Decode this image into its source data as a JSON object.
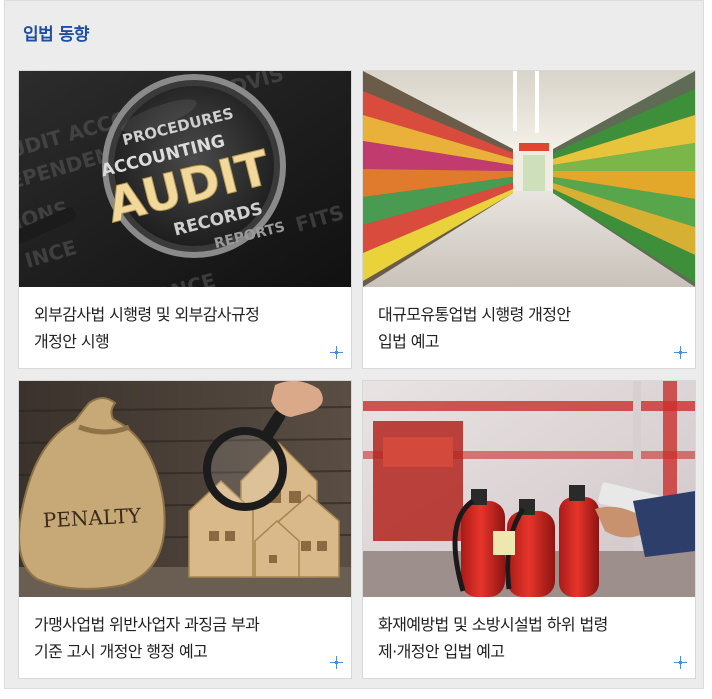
{
  "section": {
    "title": "입법 동향"
  },
  "cards": [
    {
      "caption_line1": "외부감사법 시행령 및 외부감사규정",
      "caption_line2": "개정안 시행",
      "image": "audit-magnifier",
      "image_words": [
        "PROCEDURES",
        "ACCOUNTING",
        "AUDIT",
        "RECORDS",
        "REPORTS"
      ]
    },
    {
      "caption_line1": "대규모유통업법 시행령 개정안",
      "caption_line2": "입법 예고",
      "image": "supermarket-aisle"
    },
    {
      "caption_line1": "가맹사업법 위반사업자 과징금 부과",
      "caption_line2": "기준 고시 개정안 행정 예고",
      "image": "penalty-sack-houses",
      "image_words": [
        "PENALTY"
      ]
    },
    {
      "caption_line1": "화재예방법 및 소방시설법 하위 법령",
      "caption_line2": "제·개정안 입법 예고",
      "image": "fire-extinguishers"
    }
  ],
  "icons": {
    "more": "plus-more-icon"
  },
  "colors": {
    "title": "#1f4ea3",
    "more_icon": "#4a8fd8"
  }
}
